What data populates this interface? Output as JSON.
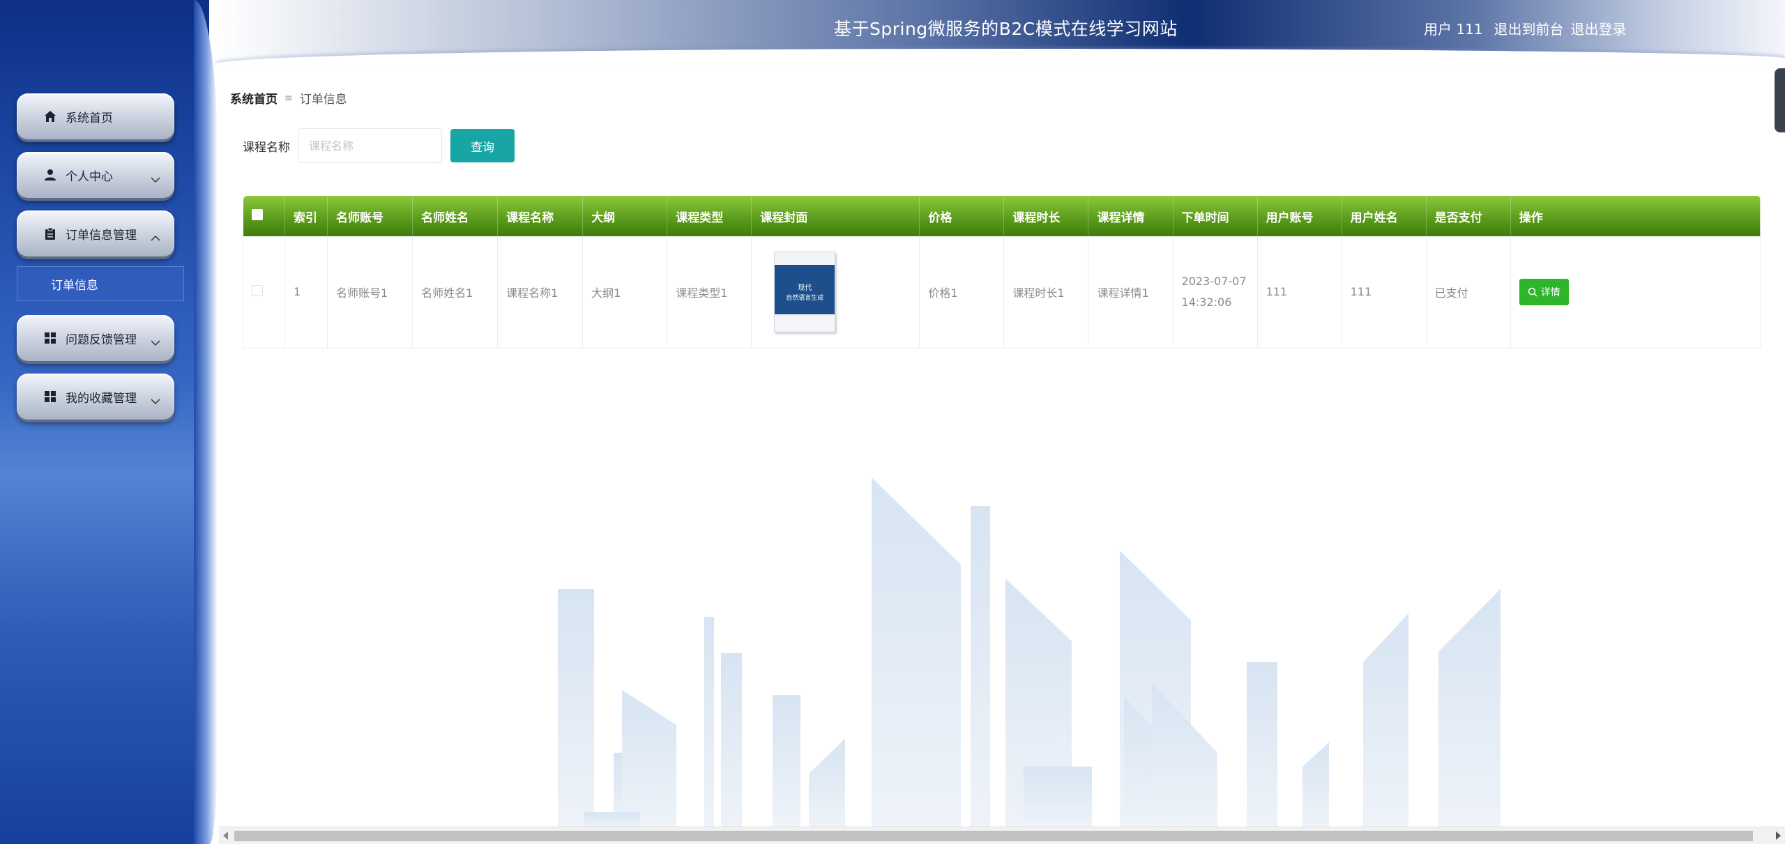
{
  "header": {
    "title": "基于Spring微服务的B2C模式在线学习网站",
    "user_label": "用户",
    "user_name": "111",
    "back_to_front": "退出到前台",
    "logout": "退出登录"
  },
  "sidebar": {
    "items": [
      {
        "label": "系统首页",
        "icon": "home-icon"
      },
      {
        "label": "个人中心",
        "icon": "user-icon"
      },
      {
        "label": "订单信息管理",
        "icon": "clipboard-icon"
      },
      {
        "label": "问题反馈管理",
        "icon": "grid-icon"
      },
      {
        "label": "我的收藏管理",
        "icon": "grid-icon"
      }
    ],
    "submenu": {
      "label": "订单信息"
    }
  },
  "breadcrumb": {
    "home": "系统首页",
    "current": "订单信息"
  },
  "search": {
    "label": "课程名称",
    "placeholder": "课程名称",
    "value": "",
    "button": "查询"
  },
  "table": {
    "headers": [
      "索引",
      "名师账号",
      "名师姓名",
      "课程名称",
      "大纲",
      "课程类型",
      "课程封面",
      "价格",
      "课程时长",
      "课程详情",
      "下单时间",
      "用户账号",
      "用户姓名",
      "是否支付",
      "操作"
    ],
    "rows": [
      {
        "index": "1",
        "teacher_account": "名师账号1",
        "teacher_name": "名师姓名1",
        "course_name": "课程名称1",
        "outline": "大纲1",
        "course_type": "课程类型1",
        "cover_title": "现代",
        "cover_subtitle": "自然语言生成",
        "price": "价格1",
        "duration": "课程时长1",
        "details": "课程详情1",
        "order_date": "2023-07-07",
        "order_time": "14:32:06",
        "user_account": "111",
        "user_name": "111",
        "paid": "已支付",
        "action": "详情"
      }
    ]
  },
  "colors": {
    "sidebar": "#1c45a2",
    "table_header": "#5c9d1c",
    "search_button": "#17a5a6",
    "detail_button": "#2fb52a"
  }
}
